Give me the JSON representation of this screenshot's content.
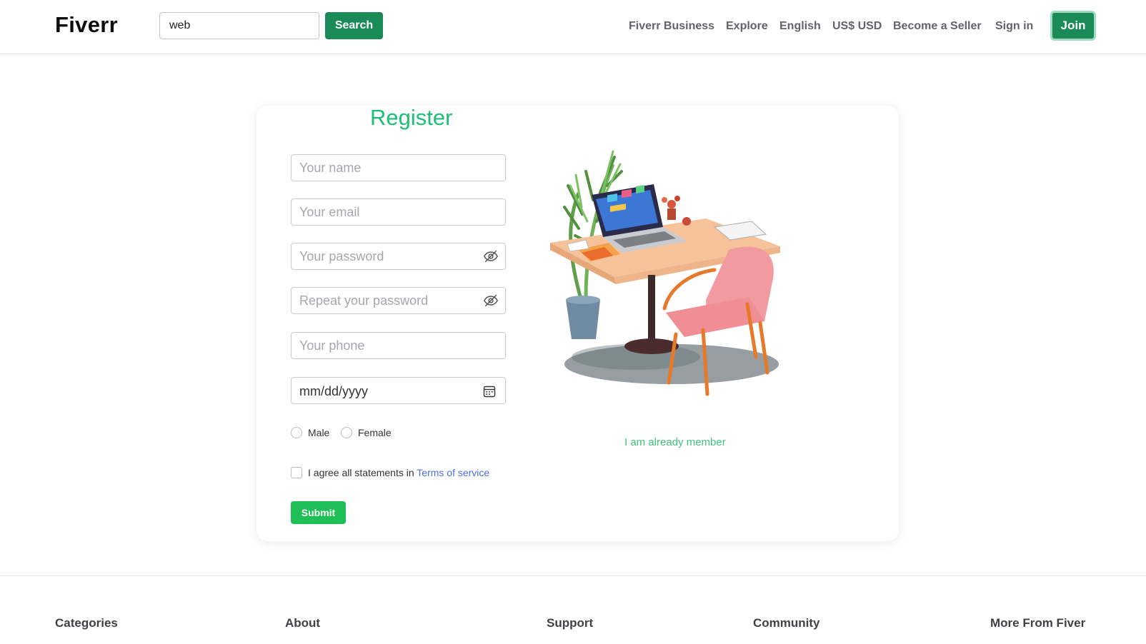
{
  "header": {
    "logo": "Fiverr",
    "search_value": "web",
    "search_button": "Search",
    "nav": [
      "Fiverr Business",
      "Explore",
      "English",
      "US$ USD",
      "Become a Seller",
      "Sign in"
    ],
    "join_button": "Join"
  },
  "register": {
    "title": "Register",
    "name_placeholder": "Your name",
    "email_placeholder": "Your email",
    "password_placeholder": "Your password",
    "repeat_password_placeholder": "Repeat your password",
    "phone_placeholder": "Your phone",
    "date_placeholder": "mm/dd/yyyy",
    "gender_options": [
      "Male",
      "Female"
    ],
    "agree_text": "I agree all statements in",
    "terms_link": "Terms of service",
    "submit_button": "Submit",
    "member_link": "I am already member"
  },
  "footer": {
    "headings": [
      "Categories",
      "About",
      "Support",
      "Community",
      "More From Fiver"
    ]
  },
  "icons": {
    "password_toggle": "eye-slash-icon",
    "date_picker": "calendar-icon"
  },
  "colors": {
    "brand_green": "#1a8a56",
    "accent_green": "#1dbf73",
    "link_blue": "#4a6fe3"
  }
}
